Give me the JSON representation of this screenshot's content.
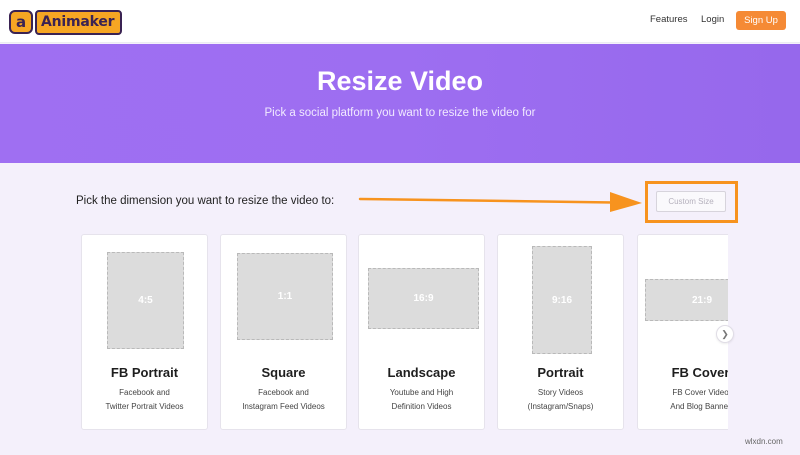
{
  "header": {
    "logo_icon": "a",
    "logo_text": "Animaker",
    "nav": {
      "features": "Features",
      "login": "Login"
    },
    "signup": "Sign Up"
  },
  "hero": {
    "title": "Resize Video",
    "subtitle": "Pick a social platform you want to resize the video for"
  },
  "main": {
    "pick_text": "Pick the dimension you want to resize the video to:",
    "custom_size": "Custom Size",
    "next_icon": "chevron-right-icon",
    "cards": [
      {
        "ratio": "4:5",
        "title": "FB Portrait",
        "desc1": "Facebook and",
        "desc2": "Twitter Portrait Videos"
      },
      {
        "ratio": "1:1",
        "title": "Square",
        "desc1": "Facebook and",
        "desc2": "Instagram Feed Videos"
      },
      {
        "ratio": "16:9",
        "title": "Landscape",
        "desc1": "Youtube and High",
        "desc2": "Definition Videos"
      },
      {
        "ratio": "9:16",
        "title": "Portrait",
        "desc1": "Story Videos",
        "desc2": "(Instagram/Snaps)"
      },
      {
        "ratio": "21:9",
        "title": "FB Cover",
        "desc1": "FB Cover Video",
        "desc2": "And Blog Banner"
      }
    ]
  },
  "colors": {
    "accent": "#f58a35",
    "highlight": "#f7931e",
    "hero": "#9f6ff2"
  },
  "watermark": "wlxdn.com"
}
